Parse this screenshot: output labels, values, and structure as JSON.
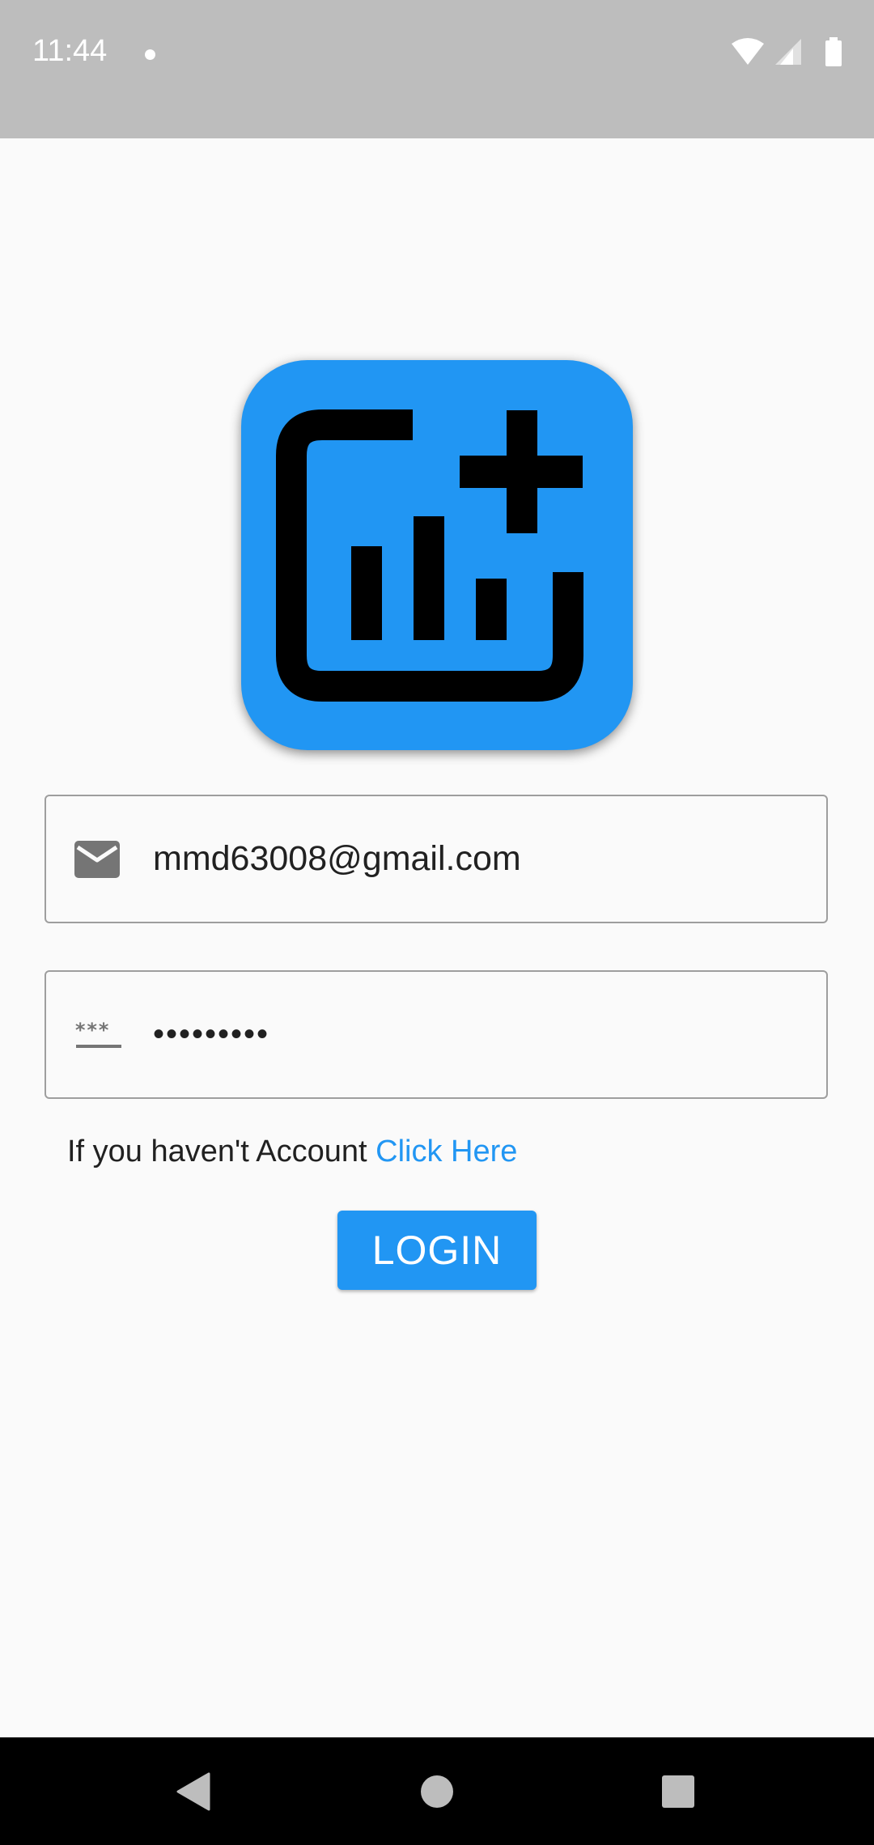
{
  "status_bar": {
    "time": "11:44"
  },
  "login_form": {
    "email": {
      "value": "mmd63008@gmail.com",
      "icon": "email-icon"
    },
    "password": {
      "value": "•••••••••",
      "icon": "password-icon"
    },
    "register_prompt": "If you haven't Account ",
    "register_link": "Click Here",
    "login_label": "LOGIN"
  },
  "colors": {
    "primary": "#2196f3",
    "status_bar": "#bdbdbd",
    "background": "#fafafa",
    "nav_bar": "#000000"
  },
  "icons": {
    "logo": "chart-add-icon",
    "nav_back": "back-icon",
    "nav_home": "home-icon",
    "nav_recents": "recents-icon"
  }
}
